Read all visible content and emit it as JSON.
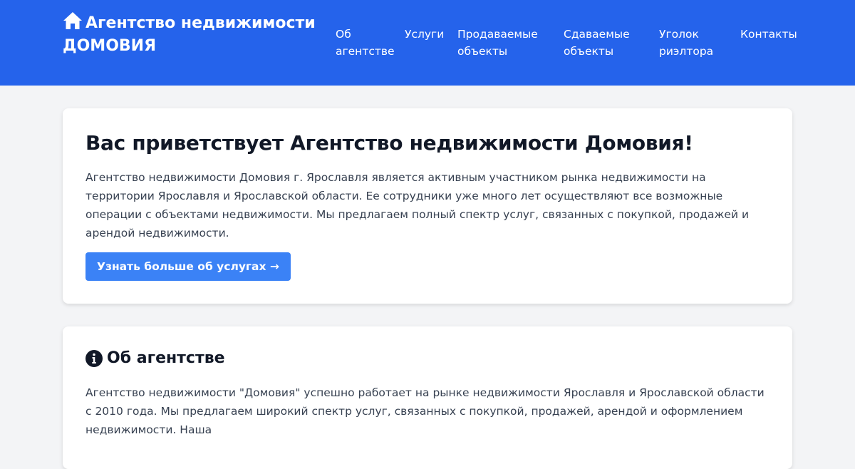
{
  "header": {
    "brand": "Агентство недвижимости ДОМОВИЯ",
    "brand_icon": "home-icon",
    "nav": [
      {
        "label": "Об агентстве"
      },
      {
        "label": "Услуги"
      },
      {
        "label": "Продаваемые объекты"
      },
      {
        "label": "Сдаваемые объекты"
      },
      {
        "label": "Уголок риэлтора"
      },
      {
        "label": "Контакты"
      }
    ]
  },
  "welcome": {
    "title": "Вас приветствует Агентство недвижимости Домовия!",
    "text": "Агентство недвижимости Домовия г. Ярославля является активным участником рынка недвижимости на территории Ярославля и Ярославской области. Ее сотрудники уже много лет осуществляют все возможные операции с объектами недвижимости. Мы предлагаем полный спектр услуг, связанных с покупкой, продажей и арендой недвижимости.",
    "button_label": "Узнать больше об услугах →"
  },
  "about": {
    "title": "Об агентстве",
    "title_icon": "info-icon",
    "text": "Агентство недвижимости \"Домовия\" успешно работает на рынке недвижимости Ярославля и Ярославской области с 2010 года. Мы предлагаем широкий спектр услуг, связанных с покупкой, продажей, арендой и оформлением недвижимости. Наша"
  },
  "colors": {
    "header_bg": "#2563eb",
    "button_bg": "#3b82f6",
    "page_bg": "#f3f4f6"
  }
}
